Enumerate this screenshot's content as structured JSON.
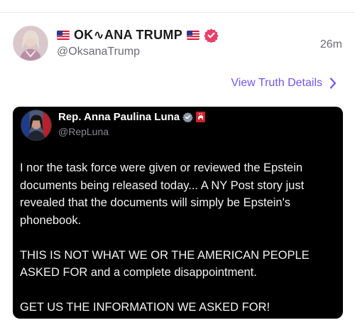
{
  "post": {
    "author": {
      "display_name": "OK∿ANA TRUMP",
      "handle": "@OksanaTrump",
      "leading_flag": "us-flag-icon",
      "trailing_flag": "us-flag-icon",
      "verified_icon": "verified-badge-icon",
      "verified_color": "#e8406a"
    },
    "timestamp": "26m",
    "details_link": {
      "label": "View Truth Details",
      "icon": "chevron-right-icon",
      "color": "#6e58f0"
    }
  },
  "embedded_post": {
    "author": {
      "display_name": "Rep. Anna Paulina Luna",
      "handle": "@RepLuna",
      "verified_icon": "gray-verified-badge-icon",
      "affiliation_icon": "republican-elephant-icon"
    },
    "paragraphs": [
      "I nor the task force were given or reviewed the Epstein documents being released today... A NY Post story just revealed that the documents will simply be Epstein's phonebook.",
      "THIS IS NOT WHAT WE OR THE AMERICAN PEOPLE ASKED FOR and a complete disappointment.",
      "GET US THE INFORMATION WE ASKED FOR!"
    ],
    "background_color": "#000000"
  }
}
